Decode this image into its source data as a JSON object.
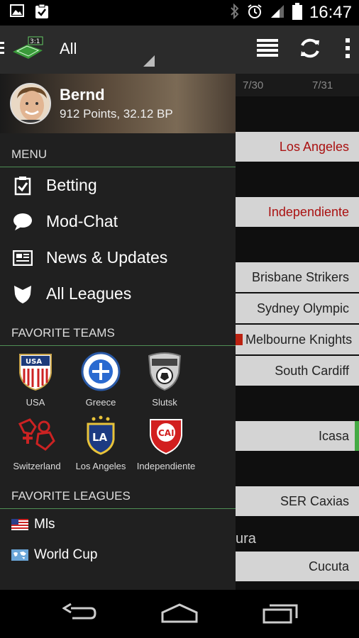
{
  "status_bar": {
    "time": "16:47",
    "left_icons": [
      "image-icon",
      "clipboard-check-icon"
    ],
    "right_icons": [
      "bluetooth-icon",
      "alarm-icon",
      "signal-icon",
      "battery-icon"
    ]
  },
  "action_bar": {
    "filter_value": "All",
    "icons": [
      "menu-lines-icon",
      "refresh-icon",
      "overflow-icon"
    ]
  },
  "background": {
    "dates": [
      "7/30",
      "7/31"
    ],
    "rows": [
      {
        "label": "Los Angeles",
        "style": "red"
      },
      {
        "label": "Independiente",
        "style": "red"
      },
      {
        "label": "Brisbane Strikers",
        "style": "normal"
      },
      {
        "label": "Sydney Olympic",
        "style": "normal"
      },
      {
        "label": "Melbourne Knights",
        "style": "flag"
      },
      {
        "label": "South Cardiff",
        "style": "normal"
      },
      {
        "label": "Icasa",
        "style": "normal"
      },
      {
        "label": "SER Caxias",
        "style": "normal"
      },
      {
        "label": "Cucuta",
        "style": "normal"
      }
    ],
    "partial_text": "ura"
  },
  "drawer": {
    "user": {
      "name": "Bernd",
      "points": "912 Points, 32.12 BP"
    },
    "menu_title": "MENU",
    "menu_items": [
      {
        "label": "Betting",
        "icon": "checklist-icon"
      },
      {
        "label": "Mod-Chat",
        "icon": "chat-bubble-icon"
      },
      {
        "label": "News & Updates",
        "icon": "newspaper-icon"
      },
      {
        "label": "All Leagues",
        "icon": "shield-icon"
      }
    ],
    "favorite_teams_title": "FAVORITE TEAMS",
    "favorite_teams": [
      {
        "name": "USA",
        "icon": "usa-crest-icon"
      },
      {
        "name": "Greece",
        "icon": "greece-crest-icon"
      },
      {
        "name": "Slutsk",
        "icon": "slutsk-crest-icon"
      },
      {
        "name": "Switzerland",
        "icon": "switzerland-crest-icon"
      },
      {
        "name": "Los Angeles",
        "icon": "la-galaxy-crest-icon"
      },
      {
        "name": "Independiente",
        "icon": "independiente-crest-icon"
      }
    ],
    "favorite_leagues_title": "FAVORITE LEAGUES",
    "favorite_leagues": [
      {
        "name": "Mls",
        "icon": "us-flag-icon"
      },
      {
        "name": "World Cup",
        "icon": "world-flag-icon"
      }
    ]
  },
  "nav_bar": {
    "icons": [
      "back-icon",
      "home-icon",
      "recents-icon"
    ]
  },
  "colors": {
    "divider": "#4f8f55",
    "drawer_bg": "#202020",
    "accent_red": "#aa1111"
  }
}
